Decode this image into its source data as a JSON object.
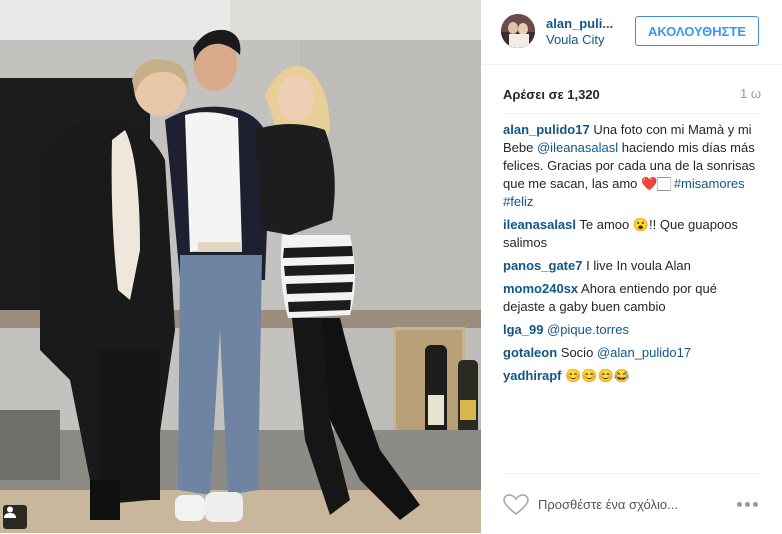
{
  "post": {
    "username": "alan_puli...",
    "location": "Voula City",
    "follow_label": "ΑΚΟΛΟΥΘΗΣΤΕ",
    "likes_text": "Αρέσει σε 1,320",
    "time_ago": "1 ω"
  },
  "comments": [
    {
      "user": "alan_pulido17",
      "parts": [
        {
          "t": " Una foto con mi Mamà y mi Bebe ",
          "link": false
        },
        {
          "t": "@ileanasalasl",
          "link": true
        },
        {
          "t": " haciendo mis días más felices. Gracias por cada una de la sonrisas que me sacan, las amo ❤️🏻 ",
          "link": false
        },
        {
          "t": "#misamores",
          "link": true
        },
        {
          "t": " ",
          "link": false
        },
        {
          "t": "#feliz",
          "link": true
        }
      ]
    },
    {
      "user": "ileanasalasl",
      "parts": [
        {
          "t": " Te amoo 😮!! Que guapoos salimos",
          "link": false
        }
      ]
    },
    {
      "user": "panos_gate7",
      "parts": [
        {
          "t": " I live In voula Alan",
          "link": false
        }
      ]
    },
    {
      "user": "momo240sx",
      "parts": [
        {
          "t": " Ahora entiendo por qué dejaste a gaby buen cambio",
          "link": false
        }
      ]
    },
    {
      "user": "lga_99",
      "parts": [
        {
          "t": " ",
          "link": false
        },
        {
          "t": "@pique.torres",
          "link": true
        }
      ]
    },
    {
      "user": "gotaleon",
      "parts": [
        {
          "t": " Socio ",
          "link": false
        },
        {
          "t": "@alan_pulido17",
          "link": true
        }
      ]
    },
    {
      "user": "yadhirapf",
      "parts": [
        {
          "t": " 😊😊😊😂",
          "link": false
        }
      ]
    }
  ],
  "footer": {
    "comment_placeholder": "Προσθέστε ένα σχόλιο..."
  },
  "icons": {
    "user_tag": "person-tag-icon",
    "like": "heart-outline-icon",
    "more": "more-options-icon"
  },
  "colors": {
    "link": "#125688",
    "follow": "#3897f0",
    "muted": "#999999"
  }
}
